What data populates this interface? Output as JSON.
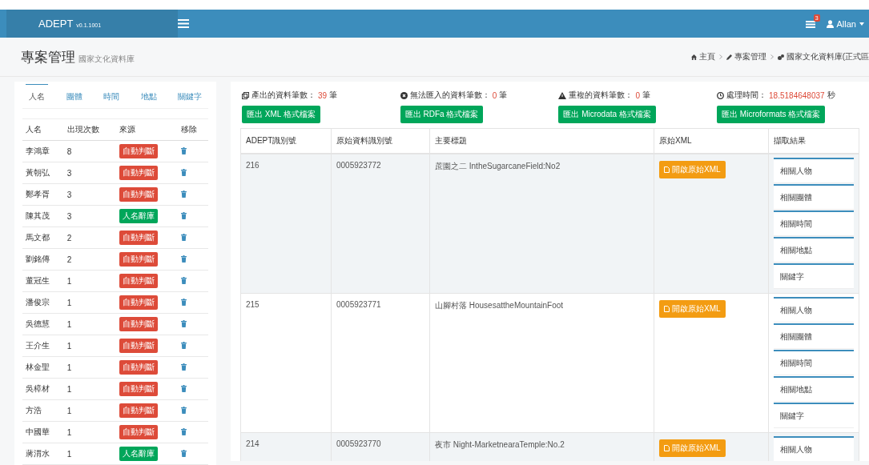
{
  "navbar": {
    "brand": "ADEPT",
    "version": "v0.1.1001",
    "notifications": "3",
    "user": "Allan"
  },
  "page": {
    "title": "專案管理",
    "subtitle": "國家文化資料庫",
    "breadcrumb": [
      "主頁",
      "專案管理",
      "國家文化資料庫(正式區"
    ]
  },
  "entity_tabs": [
    {
      "label": "人名",
      "selected": true
    },
    {
      "label": "團體",
      "selected": false
    },
    {
      "label": "時間",
      "selected": false
    },
    {
      "label": "地點",
      "selected": false
    },
    {
      "label": "關鍵字",
      "selected": false
    }
  ],
  "entity_table": {
    "columns": [
      "人名",
      "出現次數",
      "來源",
      "移除"
    ],
    "rows": [
      {
        "name": "李鴻章",
        "count": "8",
        "source": "自動判斷",
        "kind": "auto"
      },
      {
        "name": "黃朝弘",
        "count": "3",
        "source": "自動判斷",
        "kind": "auto"
      },
      {
        "name": "鄭孝胥",
        "count": "3",
        "source": "自動判斷",
        "kind": "auto"
      },
      {
        "name": "陳其茂",
        "count": "3",
        "source": "人名辭庫",
        "kind": "dictionary"
      },
      {
        "name": "馬文都",
        "count": "2",
        "source": "自動判斷",
        "kind": "auto"
      },
      {
        "name": "劉銘傳",
        "count": "2",
        "source": "自動判斷",
        "kind": "auto"
      },
      {
        "name": "董冠生",
        "count": "1",
        "source": "自動判斷",
        "kind": "auto"
      },
      {
        "name": "潘俊宗",
        "count": "1",
        "source": "自動判斷",
        "kind": "auto"
      },
      {
        "name": "吳德慧",
        "count": "1",
        "source": "自動判斷",
        "kind": "auto"
      },
      {
        "name": "王介生",
        "count": "1",
        "source": "自動判斷",
        "kind": "auto"
      },
      {
        "name": "林金聖",
        "count": "1",
        "source": "自動判斷",
        "kind": "auto"
      },
      {
        "name": "吳樟材",
        "count": "1",
        "source": "自動判斷",
        "kind": "auto"
      },
      {
        "name": "方浩",
        "count": "1",
        "source": "自動判斷",
        "kind": "auto"
      },
      {
        "name": "中國華",
        "count": "1",
        "source": "自動判斷",
        "kind": "auto"
      },
      {
        "name": "蔣渭水",
        "count": "1",
        "source": "人名辭庫",
        "kind": "dictionary"
      }
    ]
  },
  "stats": [
    {
      "kind": "output",
      "label": "產出的資料筆數：",
      "value": "39",
      "unit": "筆",
      "button": "匯出 XML 格式檔案"
    },
    {
      "kind": "failed",
      "label": "無法匯入的資料筆數：",
      "value": "0",
      "unit": "筆",
      "button": "匯出 RDFa 格式檔案"
    },
    {
      "kind": "duplicate",
      "label": "重複的資料筆數：",
      "value": "0",
      "unit": "筆",
      "button": "匯出 Microdata 格式檔案"
    },
    {
      "kind": "time",
      "label": "處理時間：",
      "value": "18.5184648037",
      "unit": "秒",
      "button": "匯出 Microformats 格式檔案"
    }
  ],
  "records": {
    "columns": [
      "ADEPT識別號",
      "原始資料識別號",
      "主要標題",
      "原始XML",
      "擷取結果"
    ],
    "rows": [
      {
        "id": "216",
        "source_id": "0005923772",
        "title": "蔗園之二 IntheSugarcaneField:No2",
        "xml_button": "開啟原始XML",
        "results": [
          "相關人物",
          "相關團體",
          "相關時間",
          "相關地點",
          "關鍵字"
        ]
      },
      {
        "id": "215",
        "source_id": "0005923771",
        "title": "山腳村落 HousesattheMountainFoot",
        "xml_button": "開啟原始XML",
        "results": [
          "相關人物",
          "相關團體",
          "相關時間",
          "相關地點",
          "關鍵字"
        ]
      },
      {
        "id": "214",
        "source_id": "0005923770",
        "title": "夜市 Night-MarketnearaTemple:No.2",
        "xml_button": "開啟原始XML",
        "results": [
          "相關人物"
        ]
      }
    ]
  }
}
